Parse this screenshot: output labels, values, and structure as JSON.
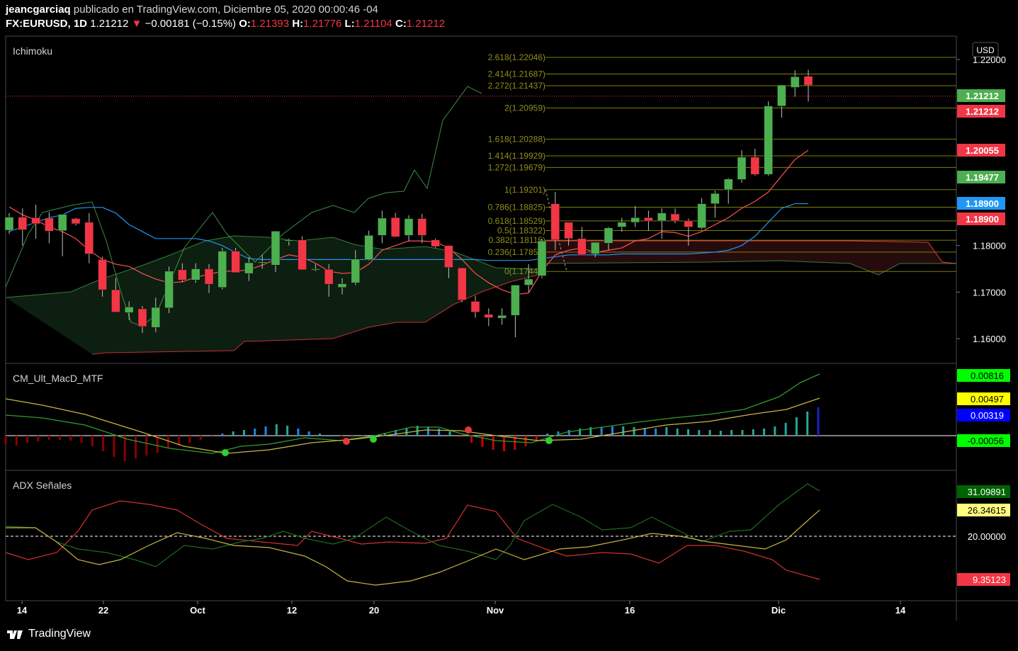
{
  "header": {
    "user": "jeancgarciaq",
    "published": "publicado en TradingView.com, Diciembre 05, 2020 00:00:46 -04",
    "symbol": "FX:EURUSD, 1D",
    "last": "1.21212",
    "change": "−0.00181 (−0.15%)",
    "o_label": "O:",
    "o": "1.21393",
    "h_label": "H:",
    "h": "1.21776",
    "l_label": "L:",
    "l": "1.21104",
    "c_label": "C:",
    "c": "1.21212"
  },
  "panes": {
    "main_title": "Ichimoku",
    "macd_title": "CM_Ult_MacD_MTF",
    "adx_title": "ADX Señales"
  },
  "currency": "USD",
  "footer": {
    "brand": "TradingView"
  },
  "colors": {
    "up": "#26a69a",
    "bull": "#4caf50",
    "bear": "#f23645",
    "kijun": "#2196f3",
    "tenkan": "#ff5252",
    "fib": "#808000"
  },
  "price_axis": [
    "1.22000",
    "1.18000",
    "1.17000",
    "1.16000"
  ],
  "price_tags": [
    {
      "label": "1.21212",
      "color": "#4caf50",
      "price": 1.21212
    },
    {
      "label": "1.21212",
      "color": "#f23645",
      "price": 1.21212
    },
    {
      "label": "1.20055",
      "color": "#f23645",
      "price": 1.20055
    },
    {
      "label": "1.19477",
      "color": "#4caf50",
      "price": 1.19477
    },
    {
      "label": "1.18900",
      "color": "#2196f3",
      "price": 1.189
    },
    {
      "label": "1.18900",
      "color": "#f23645",
      "price": 1.189
    }
  ],
  "fib_levels": [
    {
      "label": "2.618(1.22046)",
      "price": 1.22046
    },
    {
      "label": "2.414(1.21687)",
      "price": 1.21687
    },
    {
      "label": "2.272(1.21437)",
      "price": 1.21437
    },
    {
      "label": "2(1.20959)",
      "price": 1.20959
    },
    {
      "label": "1.618(1.20288)",
      "price": 1.20288
    },
    {
      "label": "1.414(1.19929)",
      "price": 1.19929
    },
    {
      "label": "1.272(1.19679)",
      "price": 1.19679
    },
    {
      "label": "1(1.19201)",
      "price": 1.19201
    },
    {
      "label": "0.786(1.18825)",
      "price": 1.18825
    },
    {
      "label": "0.618(1.18529)",
      "price": 1.18529
    },
    {
      "label": "0.5(1.18322)",
      "price": 1.18322
    },
    {
      "label": "0.382(1.18115)",
      "price": 1.18115
    },
    {
      "label": "0.236(1.17859)",
      "price": 1.17859
    },
    {
      "label": "0(1.17443)",
      "price": 1.17443
    }
  ],
  "macd_tags": [
    {
      "label": "0.00816",
      "color": "#00ff00",
      "text": "#000",
      "value": 0.00816
    },
    {
      "label": "0.00497",
      "color": "#ffff00",
      "text": "#000",
      "value": 0.00497
    },
    {
      "label": "0.00319",
      "color": "#0000ff",
      "text": "#fff",
      "value": 0.00319
    },
    {
      "label": "-0.00056",
      "color": "#00ff00",
      "text": "#000",
      "value": -0.00056
    }
  ],
  "adx_tags": [
    {
      "label": "31.09891",
      "color": "#006400",
      "text": "#fff",
      "value": 31.09891
    },
    {
      "label": "26.34615",
      "color": "#ffff80",
      "text": "#000",
      "value": 26.34615
    },
    {
      "label": "20.00000",
      "color": "#000",
      "text": "#fff",
      "value": 20
    },
    {
      "label": "9.35123",
      "color": "#f23645",
      "text": "#fff",
      "value": 9.35123
    }
  ],
  "time_axis": [
    "14",
    "22",
    "Oct",
    "12",
    "20",
    "Nov",
    "16",
    "Dic",
    "14"
  ],
  "chart_data": {
    "type": "candlestick",
    "candles": [
      {
        "o": 1.1833,
        "h": 1.187,
        "l": 1.1825,
        "c": 1.1861
      },
      {
        "o": 1.1861,
        "h": 1.188,
        "l": 1.18,
        "c": 1.1834
      },
      {
        "o": 1.186,
        "h": 1.1888,
        "l": 1.1815,
        "c": 1.1847
      },
      {
        "o": 1.1859,
        "h": 1.1872,
        "l": 1.1805,
        "c": 1.1831
      },
      {
        "o": 1.1832,
        "h": 1.1859,
        "l": 1.1777,
        "c": 1.1867
      },
      {
        "o": 1.1858,
        "h": 1.186,
        "l": 1.1843,
        "c": 1.1847
      },
      {
        "o": 1.185,
        "h": 1.187,
        "l": 1.1762,
        "c": 1.1782
      },
      {
        "o": 1.177,
        "h": 1.1776,
        "l": 1.169,
        "c": 1.1705
      },
      {
        "o": 1.1705,
        "h": 1.173,
        "l": 1.1665,
        "c": 1.1657
      },
      {
        "o": 1.1656,
        "h": 1.168,
        "l": 1.164,
        "c": 1.1668
      },
      {
        "o": 1.1664,
        "h": 1.167,
        "l": 1.1612,
        "c": 1.1626
      },
      {
        "o": 1.1624,
        "h": 1.1688,
        "l": 1.1614,
        "c": 1.1667
      },
      {
        "o": 1.1666,
        "h": 1.1755,
        "l": 1.1655,
        "c": 1.1745
      },
      {
        "o": 1.1748,
        "h": 1.1762,
        "l": 1.1722,
        "c": 1.1726
      },
      {
        "o": 1.1726,
        "h": 1.1762,
        "l": 1.172,
        "c": 1.175
      },
      {
        "o": 1.175,
        "h": 1.176,
        "l": 1.1698,
        "c": 1.1717
      },
      {
        "o": 1.171,
        "h": 1.1795,
        "l": 1.1706,
        "c": 1.1788
      },
      {
        "o": 1.1788,
        "h": 1.1795,
        "l": 1.1745,
        "c": 1.1742
      },
      {
        "o": 1.174,
        "h": 1.1775,
        "l": 1.1724,
        "c": 1.1763
      },
      {
        "o": 1.1765,
        "h": 1.178,
        "l": 1.175,
        "c": 1.1765
      },
      {
        "o": 1.1758,
        "h": 1.1828,
        "l": 1.1743,
        "c": 1.1831
      },
      {
        "o": 1.1812,
        "h": 1.1815,
        "l": 1.18,
        "c": 1.1812
      },
      {
        "o": 1.1812,
        "h": 1.182,
        "l": 1.175,
        "c": 1.1748
      },
      {
        "o": 1.175,
        "h": 1.176,
        "l": 1.1745,
        "c": 1.175
      },
      {
        "o": 1.1749,
        "h": 1.176,
        "l": 1.169,
        "c": 1.1717
      },
      {
        "o": 1.171,
        "h": 1.173,
        "l": 1.1695,
        "c": 1.1718
      },
      {
        "o": 1.172,
        "h": 1.179,
        "l": 1.1715,
        "c": 1.1771
      },
      {
        "o": 1.177,
        "h": 1.1832,
        "l": 1.1768,
        "c": 1.1822
      },
      {
        "o": 1.1822,
        "h": 1.1875,
        "l": 1.1805,
        "c": 1.1859
      },
      {
        "o": 1.186,
        "h": 1.187,
        "l": 1.1818,
        "c": 1.1819
      },
      {
        "o": 1.1822,
        "h": 1.1865,
        "l": 1.181,
        "c": 1.1858
      },
      {
        "o": 1.1858,
        "h": 1.1868,
        "l": 1.1805,
        "c": 1.1822
      },
      {
        "o": 1.1812,
        "h": 1.1815,
        "l": 1.1795,
        "c": 1.1798
      },
      {
        "o": 1.18,
        "h": 1.178,
        "l": 1.173,
        "c": 1.1753
      },
      {
        "o": 1.1752,
        "h": 1.175,
        "l": 1.1678,
        "c": 1.1683
      },
      {
        "o": 1.168,
        "h": 1.1692,
        "l": 1.1645,
        "c": 1.1657
      },
      {
        "o": 1.1652,
        "h": 1.1665,
        "l": 1.1627,
        "c": 1.1645
      },
      {
        "o": 1.1644,
        "h": 1.1665,
        "l": 1.163,
        "c": 1.165
      },
      {
        "o": 1.165,
        "h": 1.1702,
        "l": 1.1603,
        "c": 1.1715
      },
      {
        "o": 1.1715,
        "h": 1.176,
        "l": 1.17,
        "c": 1.1728
      },
      {
        "o": 1.1735,
        "h": 1.1815,
        "l": 1.173,
        "c": 1.181
      },
      {
        "o": 1.189,
        "h": 1.1915,
        "l": 1.179,
        "c": 1.1812
      },
      {
        "o": 1.185,
        "h": 1.1848,
        "l": 1.18,
        "c": 1.1815
      },
      {
        "o": 1.1815,
        "h": 1.184,
        "l": 1.179,
        "c": 1.178
      },
      {
        "o": 1.1782,
        "h": 1.1805,
        "l": 1.1775,
        "c": 1.1807
      },
      {
        "o": 1.1805,
        "h": 1.184,
        "l": 1.179,
        "c": 1.1838
      },
      {
        "o": 1.184,
        "h": 1.186,
        "l": 1.183,
        "c": 1.185
      },
      {
        "o": 1.185,
        "h": 1.1885,
        "l": 1.184,
        "c": 1.186
      },
      {
        "o": 1.186,
        "h": 1.1875,
        "l": 1.1832,
        "c": 1.1853
      },
      {
        "o": 1.1853,
        "h": 1.188,
        "l": 1.1815,
        "c": 1.187
      },
      {
        "o": 1.1868,
        "h": 1.188,
        "l": 1.1848,
        "c": 1.1853
      },
      {
        "o": 1.1853,
        "h": 1.1858,
        "l": 1.18,
        "c": 1.184
      },
      {
        "o": 1.1838,
        "h": 1.1902,
        "l": 1.1835,
        "c": 1.189
      },
      {
        "o": 1.189,
        "h": 1.1918,
        "l": 1.186,
        "c": 1.1912
      },
      {
        "o": 1.192,
        "h": 1.1945,
        "l": 1.189,
        "c": 1.1943
      },
      {
        "o": 1.1942,
        "h": 1.2005,
        "l": 1.1935,
        "c": 1.199
      },
      {
        "o": 1.199,
        "h": 1.2008,
        "l": 1.195,
        "c": 1.1953
      },
      {
        "o": 1.1953,
        "h": 1.211,
        "l": 1.195,
        "c": 1.21
      },
      {
        "o": 1.21,
        "h": 1.2125,
        "l": 1.2075,
        "c": 1.2145
      },
      {
        "o": 1.214,
        "h": 1.2177,
        "l": 1.212,
        "c": 1.2163
      },
      {
        "o": 1.2164,
        "h": 1.2178,
        "l": 1.211,
        "c": 1.2145
      }
    ],
    "tenkan": [
      1.1883,
      1.1866,
      1.1855,
      1.184,
      1.183,
      1.1815,
      1.179,
      1.177,
      1.176,
      1.1755,
      1.174,
      1.1728,
      1.172,
      1.1722,
      1.1732,
      1.1738,
      1.1745,
      1.1745,
      1.1748,
      1.1758,
      1.177,
      1.178,
      1.1775,
      1.1762,
      1.1745,
      1.174,
      1.1742,
      1.176,
      1.179,
      1.18,
      1.181,
      1.181,
      1.1808,
      1.1795,
      1.177,
      1.174,
      1.172,
      1.1705,
      1.1695,
      1.1698,
      1.1745,
      1.178,
      1.179,
      1.1795,
      1.1785,
      1.179,
      1.1795,
      1.181,
      1.1815,
      1.183,
      1.1828,
      1.182,
      1.183,
      1.1845,
      1.186,
      1.188,
      1.1895,
      1.1915,
      1.195,
      1.1985,
      1.2005
    ],
    "kijun": [
      1.183,
      1.184,
      1.185,
      1.186,
      1.1866,
      1.188,
      1.1882,
      1.1882,
      1.187,
      1.1845,
      1.183,
      1.1815,
      1.1815,
      1.1815,
      1.1815,
      1.181,
      1.18,
      1.1785,
      1.1772,
      1.177,
      1.177,
      1.177,
      1.177,
      1.177,
      1.177,
      1.177,
      1.177,
      1.177,
      1.177,
      1.177,
      1.177,
      1.177,
      1.177,
      1.177,
      1.177,
      1.177,
      1.1768,
      1.1768,
      1.1768,
      1.1768,
      1.1772,
      1.1776,
      1.178,
      1.178,
      1.178,
      1.178,
      1.1782,
      1.1782,
      1.1782,
      1.1782,
      1.1782,
      1.1782,
      1.1784,
      1.1786,
      1.179,
      1.18,
      1.182,
      1.185,
      1.188,
      1.189,
      1.189
    ]
  }
}
